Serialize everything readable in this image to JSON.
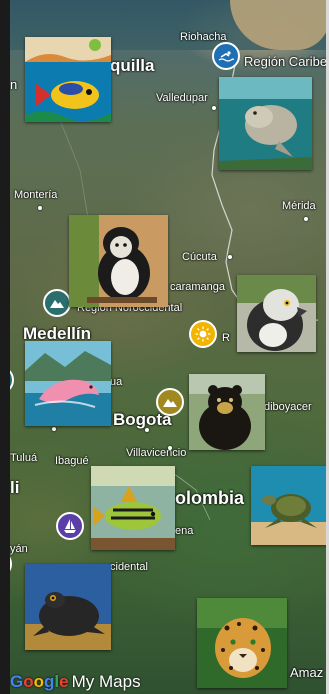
{
  "map": {
    "places": {
      "riohacha": "Riohacha",
      "region_caribe": "Región Caribe",
      "barranquilla": "quilla",
      "valledupar": "Valledupar",
      "monteria": "Montería",
      "merida": "Mérida",
      "cucuta": "Cúcuta",
      "bucaramanga": "caramanga",
      "region_noroccidental": "Región Noroccidental",
      "medellin": "Medellín",
      "region_r": "R",
      "ua": "ua",
      "bogota": "Bogotá",
      "diboyacense": "diboyacer",
      "villavicencio": "Villavicencio",
      "tulua": "Tuluá",
      "ibague": "Ibagué",
      "colombia": "olombia",
      "ali": "li",
      "ena": "ena",
      "yan": "yán",
      "region_pacifica": "cidental",
      "amazonia": "Amaz",
      "left_cut": "n"
    },
    "pins": [
      {
        "name": "swimming-pin",
        "color": "#1f6fb5",
        "icon": "swimmer"
      },
      {
        "name": "mountain-pin-north",
        "color": "#2a6f6e",
        "icon": "mountain"
      },
      {
        "name": "sun-pin",
        "color": "#f1b400",
        "icon": "sun"
      },
      {
        "name": "mountain-pin-center",
        "color": "#a08a1f",
        "icon": "mountain"
      },
      {
        "name": "sailboat-pin",
        "color": "#5a3fa8",
        "icon": "sailboat"
      }
    ],
    "photos": [
      {
        "name": "colorful-fish-photo",
        "subject": "tropical fish"
      },
      {
        "name": "manatee-photo",
        "subject": "manatee"
      },
      {
        "name": "monkey-photo",
        "subject": "white-faced monkey"
      },
      {
        "name": "eagle-photo",
        "subject": "harpy eagle"
      },
      {
        "name": "pink-dolphin-photo",
        "subject": "pink river dolphin"
      },
      {
        "name": "bear-photo",
        "subject": "spectacled bear"
      },
      {
        "name": "striped-fish-photo",
        "subject": "striped fish"
      },
      {
        "name": "turtle-photo",
        "subject": "sea turtle"
      },
      {
        "name": "frog-photo",
        "subject": "dark frog"
      },
      {
        "name": "jaguar-photo",
        "subject": "jaguar"
      }
    ],
    "attribution": {
      "brand": "Google",
      "product": "My Maps"
    }
  }
}
